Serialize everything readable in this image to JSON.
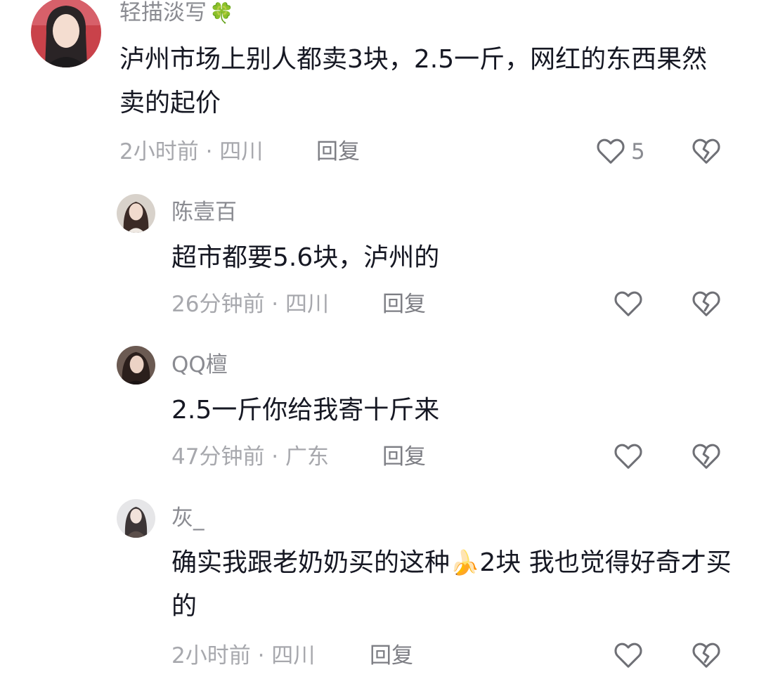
{
  "comments": [
    {
      "username": "轻描淡写",
      "username_emoji": "🍀",
      "text": "泸州市场上别人都卖3块，2.5一斤，网红的东西果然卖的起价",
      "time": "2小时前",
      "location": "四川",
      "reply_label": "回复",
      "like_count": "5"
    },
    {
      "username": "陈壹百",
      "text": "超市都要5.6块，泸州的",
      "time": "26分钟前",
      "location": "四川",
      "reply_label": "回复",
      "like_count": ""
    },
    {
      "username": "QQ檀",
      "text": "2.5一斤你给我寄十斤来",
      "time": "47分钟前",
      "location": "广东",
      "reply_label": "回复",
      "like_count": ""
    },
    {
      "username": "灰_",
      "text_before_emoji": "确实我跟老奶奶买的这种",
      "text_emoji": "🍌",
      "text_after_emoji": "2块 我也觉得好奇才买的",
      "time": "2小时前",
      "location": "四川",
      "reply_label": "回复",
      "like_count": ""
    }
  ],
  "meta_separator": " · ",
  "icons": {
    "like": "heart-outline-icon",
    "dislike": "broken-heart-outline-icon"
  },
  "colors": {
    "text": "#161823",
    "meta": "#a7a8ad",
    "icon": "#6f7076"
  }
}
